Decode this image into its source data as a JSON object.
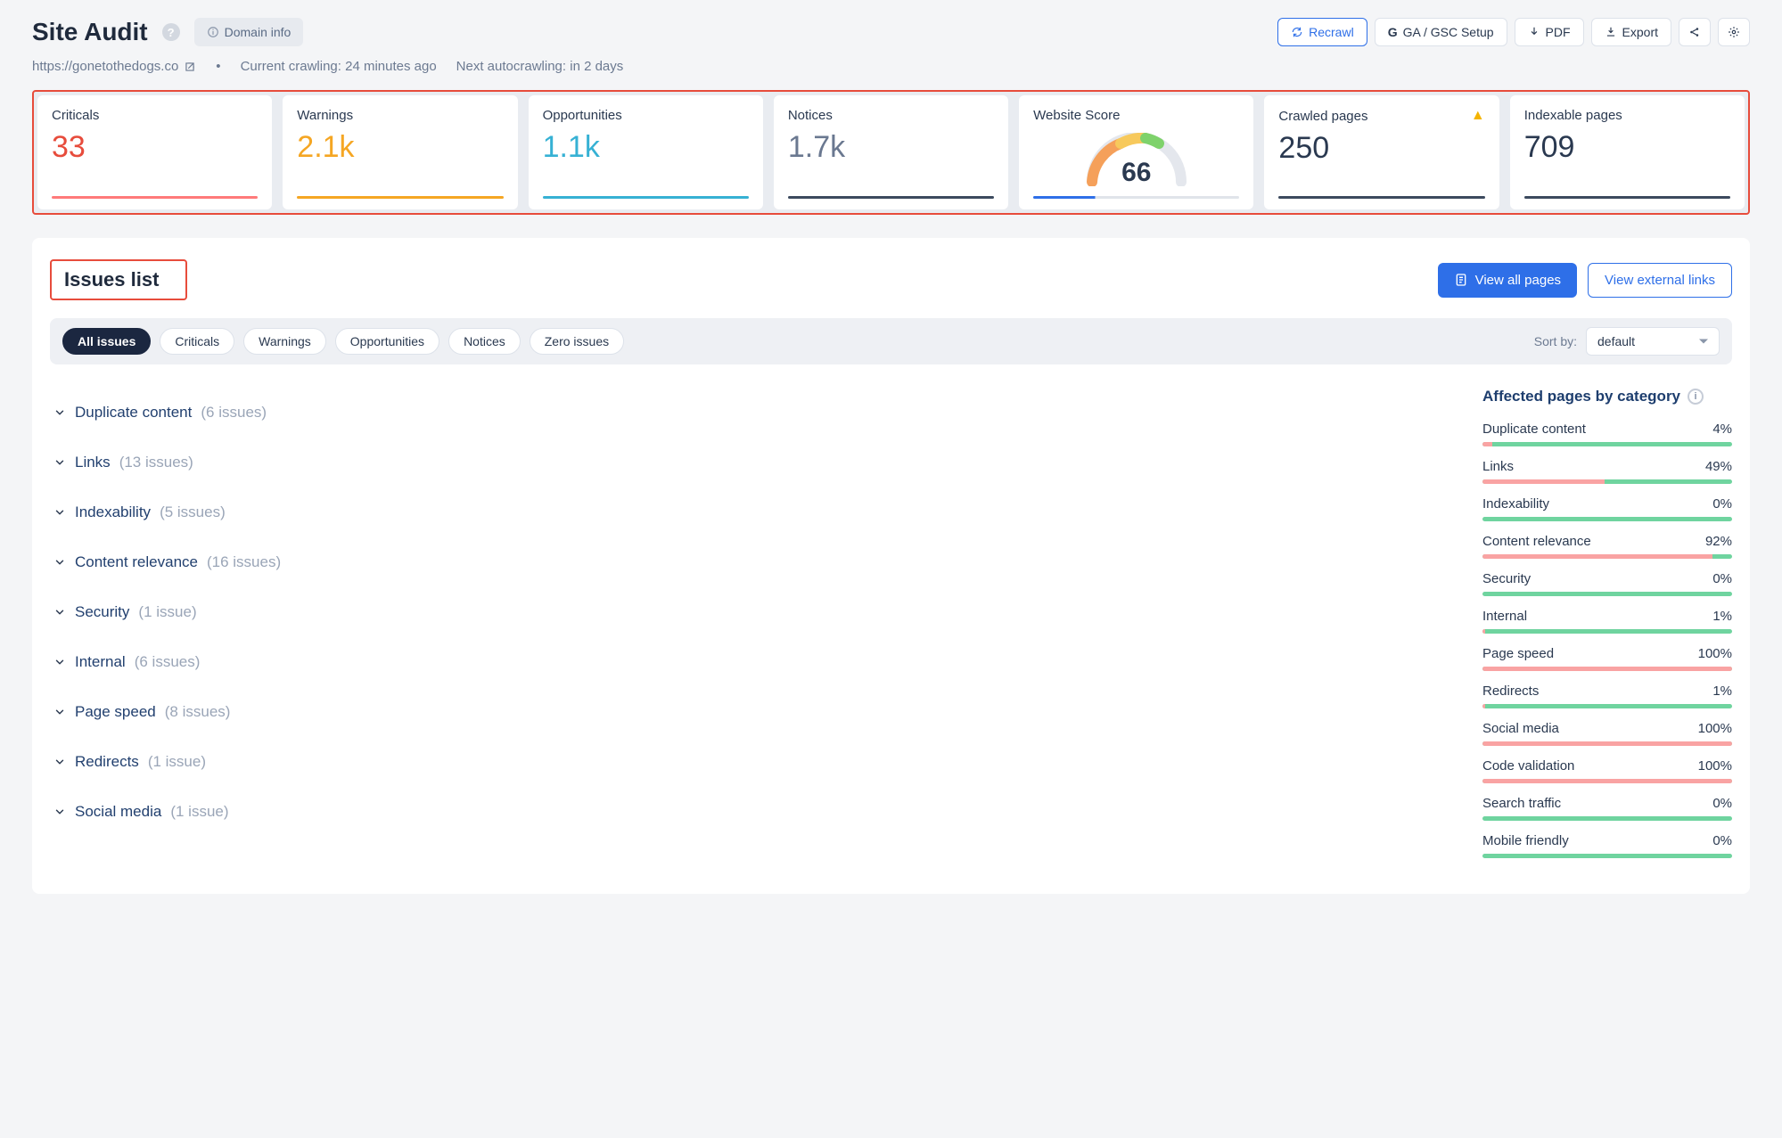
{
  "header": {
    "title": "Site Audit",
    "domain_btn": "Domain info",
    "actions": {
      "recrawl": "Recrawl",
      "gagsc": "GA / GSC Setup",
      "pdf": "PDF",
      "export": "Export"
    }
  },
  "meta": {
    "url": "https://gonetothedogs.co",
    "crawl_status": "Current crawling: 24 minutes ago",
    "next_crawl": "Next autocrawling: in 2 days"
  },
  "summary": {
    "criticals": {
      "label": "Criticals",
      "value": "33"
    },
    "warnings": {
      "label": "Warnings",
      "value": "2.1k"
    },
    "opps": {
      "label": "Opportunities",
      "value": "1.1k"
    },
    "notices": {
      "label": "Notices",
      "value": "1.7k"
    },
    "score": {
      "label": "Website Score",
      "value": "66"
    },
    "crawled": {
      "label": "Crawled pages",
      "value": "250"
    },
    "indexable": {
      "label": "Indexable pages",
      "value": "709"
    }
  },
  "issues": {
    "title": "Issues list",
    "view_all": "View all pages",
    "view_ext": "View external links",
    "filters": [
      "All issues",
      "Criticals",
      "Warnings",
      "Opportunities",
      "Notices",
      "Zero issues"
    ],
    "sort_label": "Sort by:",
    "sort_value": "default",
    "list": [
      {
        "name": "Duplicate content",
        "count": "(6 issues)"
      },
      {
        "name": "Links",
        "count": "(13 issues)"
      },
      {
        "name": "Indexability",
        "count": "(5 issues)"
      },
      {
        "name": "Content relevance",
        "count": "(16 issues)"
      },
      {
        "name": "Security",
        "count": "(1 issue)"
      },
      {
        "name": "Internal",
        "count": "(6 issues)"
      },
      {
        "name": "Page speed",
        "count": "(8 issues)"
      },
      {
        "name": "Redirects",
        "count": "(1 issue)"
      },
      {
        "name": "Social media",
        "count": "(1 issue)"
      }
    ]
  },
  "sidebar": {
    "title": "Affected pages by category",
    "categories": [
      {
        "name": "Duplicate content",
        "pct": "4%",
        "fill": 4
      },
      {
        "name": "Links",
        "pct": "49%",
        "fill": 49
      },
      {
        "name": "Indexability",
        "pct": "0%",
        "fill": 0
      },
      {
        "name": "Content relevance",
        "pct": "92%",
        "fill": 92
      },
      {
        "name": "Security",
        "pct": "0%",
        "fill": 0
      },
      {
        "name": "Internal",
        "pct": "1%",
        "fill": 1
      },
      {
        "name": "Page speed",
        "pct": "100%",
        "fill": 100
      },
      {
        "name": "Redirects",
        "pct": "1%",
        "fill": 1
      },
      {
        "name": "Social media",
        "pct": "100%",
        "fill": 100
      },
      {
        "name": "Code validation",
        "pct": "100%",
        "fill": 100
      },
      {
        "name": "Search traffic",
        "pct": "0%",
        "fill": 0
      },
      {
        "name": "Mobile friendly",
        "pct": "0%",
        "fill": 0
      }
    ]
  }
}
